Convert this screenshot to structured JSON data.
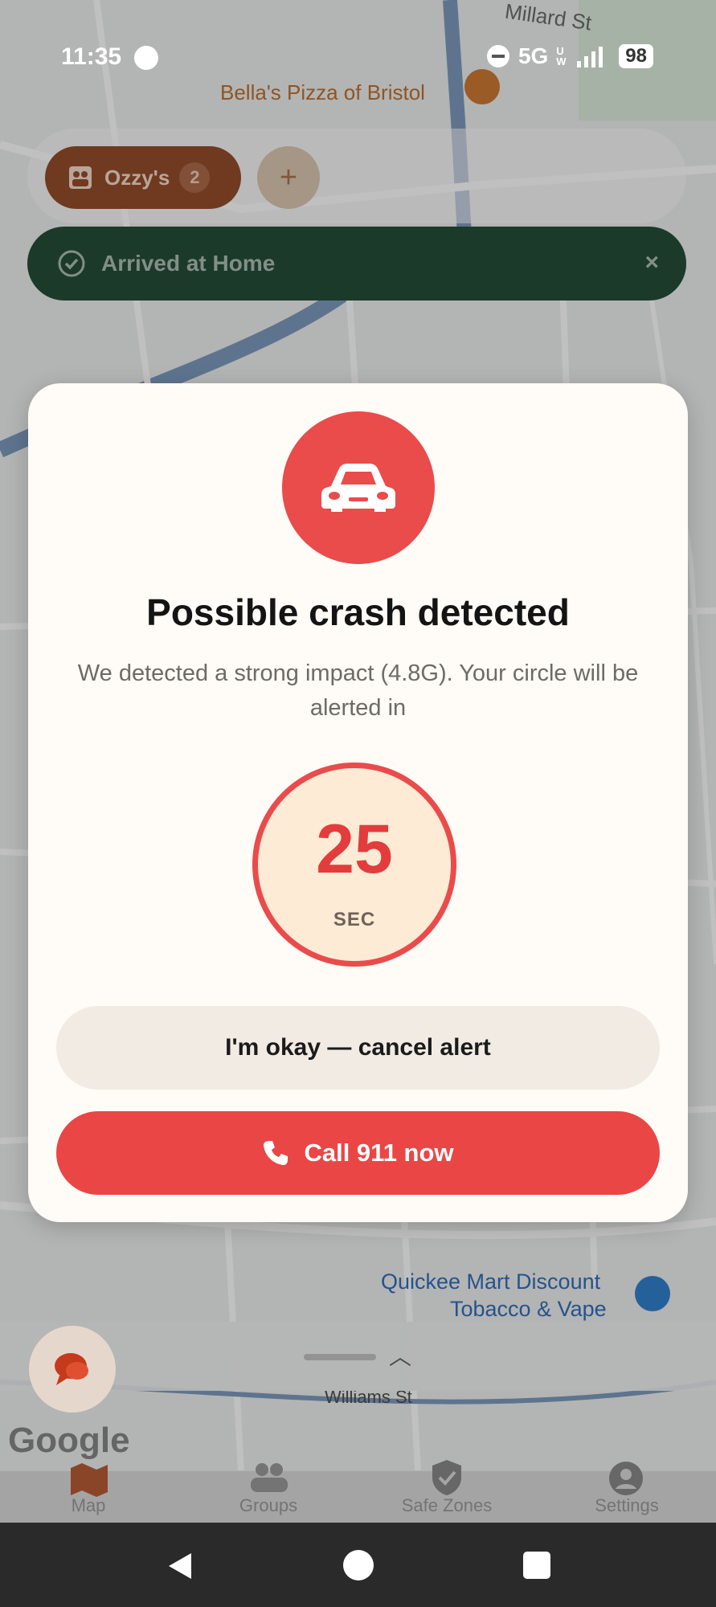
{
  "status_bar": {
    "time": "11:35",
    "network": "5G",
    "network_sub": "UW",
    "battery": "98"
  },
  "map": {
    "labels": {
      "poi_pizza": "Bella's Pizza of Bristol",
      "street_millard": "Millard St",
      "street_williams": "Williams St",
      "poi_quickee_line1": "Quickee Mart Discount",
      "poi_quickee_line2": "Tobacco & Vape"
    },
    "attribution": "Google"
  },
  "header": {
    "group_chip": {
      "label": "Ozzy's",
      "count": "2"
    },
    "add_label": "+"
  },
  "arrival_banner": {
    "text": "Arrived at Home",
    "close": "×"
  },
  "crash_modal": {
    "title": "Possible crash detected",
    "description": "We detected a strong impact (4.8G). Your circle will be alerted in",
    "countdown": {
      "value": "25",
      "unit": "SEC"
    },
    "cancel_label": "I'm okay — cancel alert",
    "call_label": "Call 911 now"
  },
  "bottom_nav": {
    "tabs": [
      {
        "label": "Map"
      },
      {
        "label": "Groups"
      },
      {
        "label": "Safe Zones"
      },
      {
        "label": "Settings"
      }
    ]
  },
  "colors": {
    "accent_red": "#ea4b4b",
    "banner_green": "#0c3a22",
    "chip_brown": "#8a3a14",
    "timer_bg": "#fdebd6"
  }
}
